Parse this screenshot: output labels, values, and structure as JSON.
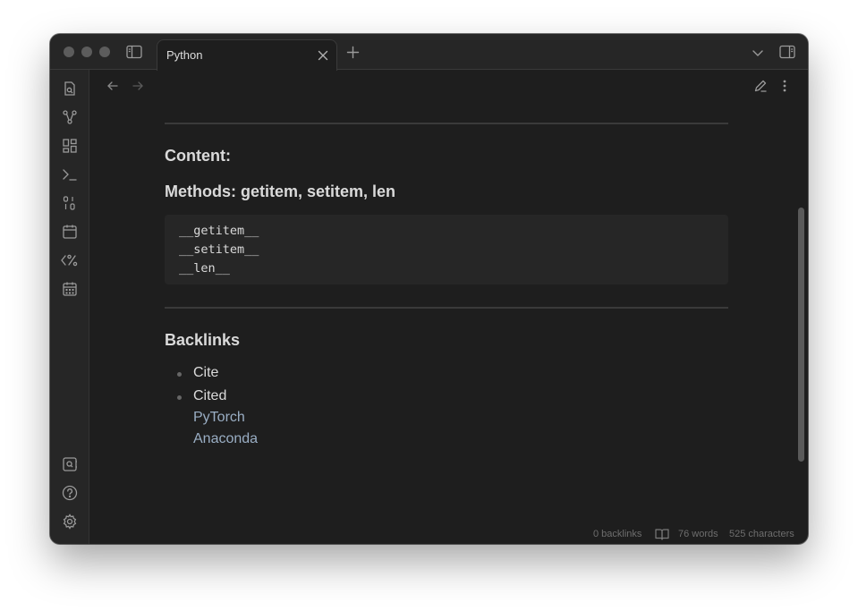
{
  "tab": {
    "title": "Python"
  },
  "note": {
    "headings": {
      "content": "Content:",
      "methods": "Methods: getitem, setitem, len",
      "backlinks": "Backlinks"
    },
    "code_lines": [
      "__getitem__",
      "__setitem__",
      "__len__"
    ],
    "backlinks_list": [
      {
        "label": "Cite"
      },
      {
        "label": "Cited",
        "links": [
          "PyTorch",
          "Anaconda"
        ]
      }
    ]
  },
  "statusbar": {
    "backlinks": "0 backlinks",
    "words": "76 words",
    "characters": "525 characters"
  },
  "ribbon_icons": [
    "quick-switcher-icon",
    "graph-view-icon",
    "canvas-icon",
    "terminal-icon",
    "random-note-icon",
    "daily-note-icon",
    "templater-icon",
    "calendar-icon",
    "vault-switcher-icon",
    "help-icon",
    "settings-icon"
  ],
  "colors": {
    "background": "#1e1e1e",
    "chrome": "#262626",
    "text": "#dadada",
    "link": "#9aaec4",
    "muted": "#6e6e6e"
  }
}
